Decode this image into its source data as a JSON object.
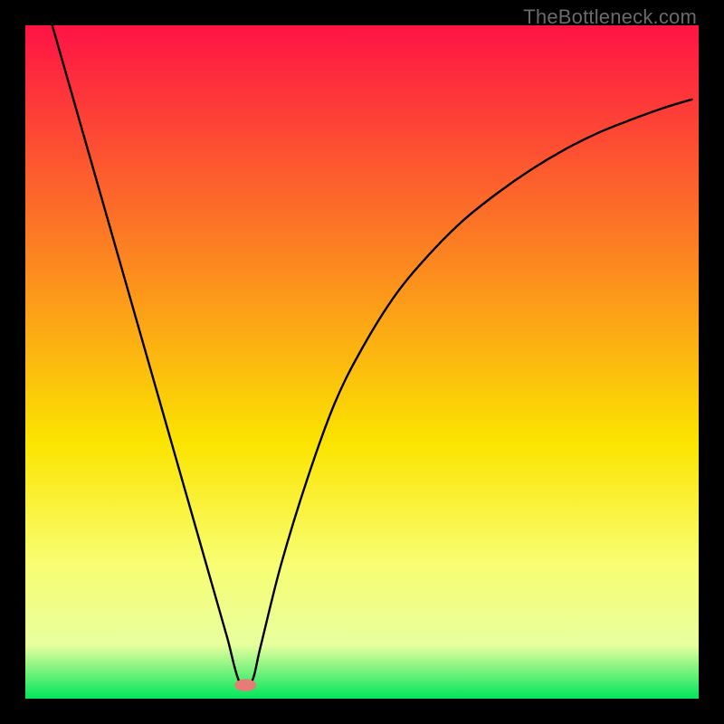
{
  "watermark": "TheBottleneck.com",
  "chart_data": {
    "type": "line",
    "title": "",
    "xlabel": "",
    "ylabel": "",
    "xlim": [
      0,
      100
    ],
    "ylim": [
      0,
      100
    ],
    "grid": false,
    "series": [
      {
        "name": "curve",
        "x": [
          4,
          6,
          8,
          10,
          12,
          14,
          16,
          18,
          20,
          22,
          24,
          26,
          28,
          30,
          31.8,
          33.6,
          35,
          38,
          42,
          46,
          50,
          55,
          60,
          65,
          70,
          75,
          80,
          85,
          90,
          95,
          99
        ],
        "y": [
          100,
          93,
          86,
          79,
          72,
          65,
          58,
          51,
          44,
          37,
          30,
          23,
          16,
          9,
          2.5,
          2.5,
          8,
          20,
          33,
          44,
          52,
          60,
          66,
          71,
          75,
          78.5,
          81.5,
          84,
          86,
          87.8,
          89
        ]
      }
    ],
    "colors": {
      "gradient_top": "#fe1345",
      "gradient_mid1": "#fc8a1f",
      "gradient_mid2": "#fbe400",
      "gradient_mid3": "#f8fe72",
      "gradient_bottom": "#00e55b",
      "curve": "#000000",
      "marker": "#e77b76"
    },
    "marker": {
      "x": 32.7,
      "y": 2.0,
      "rx": 1.6,
      "ry": 0.9
    }
  }
}
